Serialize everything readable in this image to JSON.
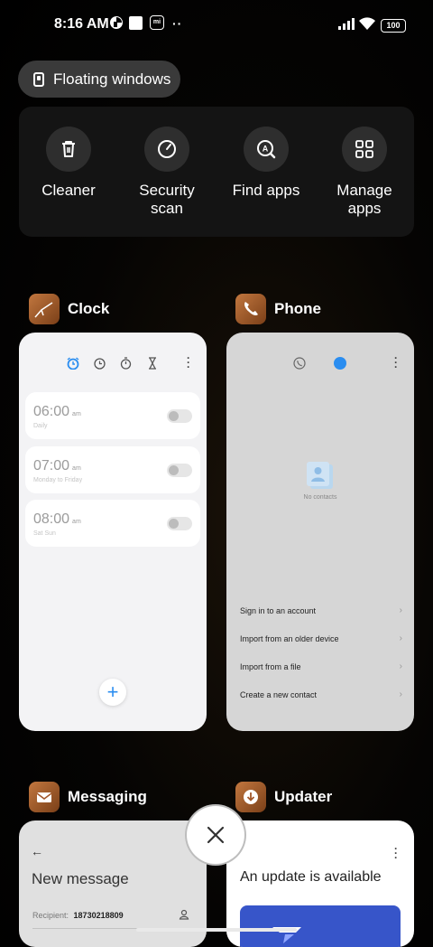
{
  "status_bar": {
    "time": "8:16 AM",
    "battery": "100",
    "mi_badge": "mi"
  },
  "floating_windows": {
    "label": "Floating windows"
  },
  "quick_actions": [
    {
      "label": "Cleaner",
      "icon": "trash-icon"
    },
    {
      "label": "Security scan",
      "icon": "gauge-icon"
    },
    {
      "label": "Find apps",
      "icon": "app-search-icon"
    },
    {
      "label": "Manage apps",
      "icon": "grid-icon"
    }
  ],
  "apps": {
    "clock": {
      "name": "Clock",
      "alarms": [
        {
          "time": "06:00",
          "ampm": "am",
          "repeat": "Daily"
        },
        {
          "time": "07:00",
          "ampm": "am",
          "repeat": "Monday to Friday"
        },
        {
          "time": "08:00",
          "ampm": "am",
          "repeat": "Sat Sun"
        }
      ],
      "add_label": "+"
    },
    "phone": {
      "name": "Phone",
      "empty_text": "No contacts",
      "options": [
        "Sign in to an account",
        "Import from an older device",
        "Import from a file",
        "Create a new contact"
      ]
    },
    "messaging": {
      "name": "Messaging",
      "title": "New message",
      "recipient_label": "Recipient:",
      "recipient_value": "18730218809"
    },
    "updater": {
      "name": "Updater",
      "title": "An update is available"
    }
  },
  "colors": {
    "accent": "#2a8df0",
    "app_icon": "#b0672f"
  }
}
